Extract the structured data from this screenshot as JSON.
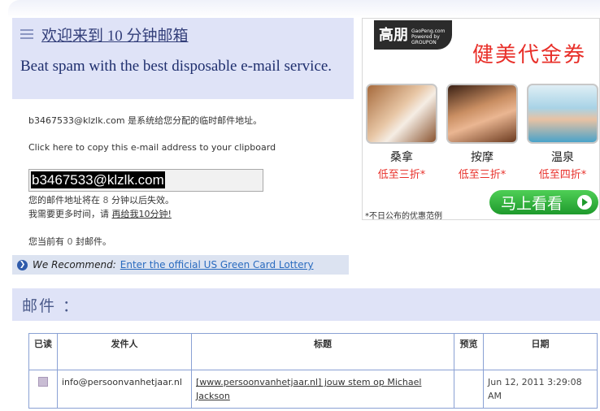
{
  "header": {
    "welcome": "欢迎来到 10 分钟邮箱",
    "tagline": "Beat spam with the best disposable e-mail service."
  },
  "mailbox": {
    "address_line_email": "b3467533@klzlk.com",
    "address_line_suffix": " 是系统给您分配的临时邮件地址。",
    "copy_hint": "Click here to copy this e-mail address to your clipboard",
    "email_value": "b3467533@klzlk.com",
    "expiry_prefix": "您的邮件地址将在 ",
    "expiry_minutes": "8",
    "expiry_suffix": " 分钟以后失效。",
    "more_time_prefix": "我需要更多时间，请 ",
    "more_time_link": "再给我10分钟!",
    "count_prefix": "您当前有 ",
    "count_value": "0",
    "count_suffix": " 封邮件。"
  },
  "recommend": {
    "label": "We Recommend:",
    "link": "Enter the official US Green Card Lottery"
  },
  "ad": {
    "logo_big": "高朋",
    "logo_small": "GaoPeng.com Powered by GROUPON",
    "headline": "健美代金券",
    "items": [
      {
        "name": "桑拿",
        "price": "低至三折*"
      },
      {
        "name": "按摩",
        "price": "低至三折*"
      },
      {
        "name": "温泉",
        "price": "低至四折*"
      }
    ],
    "note": "*不日公布的优惠范例",
    "button": "马上看看"
  },
  "mail_section": {
    "title": "邮件 ："
  },
  "table": {
    "headers": {
      "read": "已读",
      "sender": "发件人",
      "subject": "标题",
      "preview": "预览",
      "date": "日期"
    },
    "rows": [
      {
        "sender": "info@persoonvanhetjaar.nl",
        "subject": "[www.persoonvanhetjaar.nl] jouw stem op Michael Jackson",
        "preview": "",
        "date": "Jun 12, 2011 3:29:08 AM"
      }
    ]
  },
  "colors": {
    "panel": "#dfe3f7",
    "accent_red": "#e8302a",
    "link_blue": "#2a6bbf",
    "button_green": "#1e9a2c"
  }
}
